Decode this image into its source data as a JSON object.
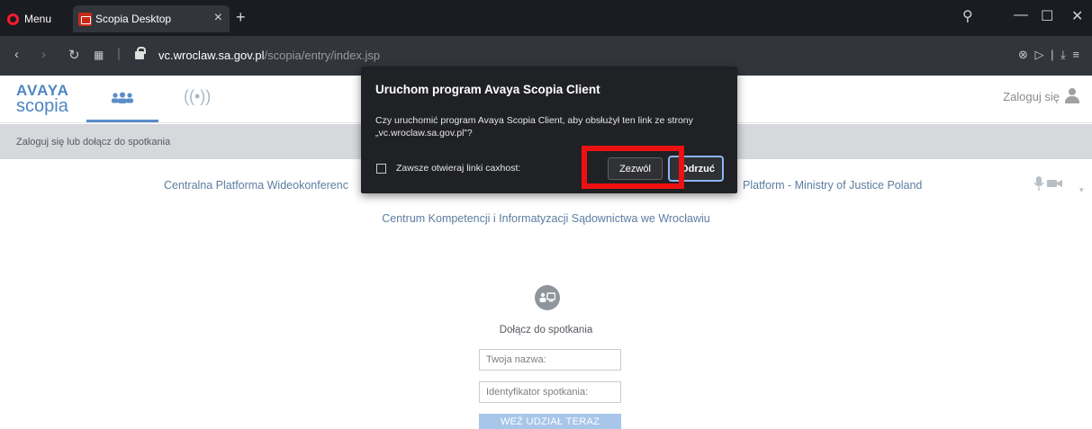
{
  "browser": {
    "menu_label": "Menu",
    "tab_title": "Scopia Desktop",
    "tab_close": "×",
    "new_tab": "+",
    "url_host": "vc.wroclaw.sa.gov.pl",
    "url_path": "/scopia/entry/index.jsp",
    "window_controls": {
      "search": "⚲",
      "minimize": "—",
      "maximize": "☐",
      "close": "✕"
    },
    "right_icons": "⊗ ▷ | ⤓ ≡",
    "brand_color": "#ff1b2d"
  },
  "header": {
    "logo_top": "AVAYA",
    "logo_bottom": "scopia",
    "people_icon": "people-icon",
    "broadcast_icon": "((•))",
    "login_label": "Zaloguj się",
    "accent_color": "#5b8ec9"
  },
  "subbar": {
    "text": "Zaloguj się lub dołącz do spotkania"
  },
  "main": {
    "platform_left": "Centralna Platforma Wideokonferenc",
    "platform_right": "Platform - Ministry of Justice Poland",
    "center_line": "Centrum Kompetencji i Informatyzacji Sądownictwa we Wrocławiu",
    "join_title": "Dołącz do spotkania",
    "name_placeholder": "Twoja nazwa:",
    "meeting_id_placeholder": "Identyfikator spotkania:",
    "join_button": "WEŹ UDZIAŁ TERAZ"
  },
  "dialog": {
    "title": "Uruchom program Avaya Scopia Client",
    "message": "Czy uruchomić program Avaya Scopia Client, aby obsłużył ten link ze strony „vc.wroclaw.sa.gov.pl”?",
    "checkbox_label": "Zawsze otwieraj linki caxhost:",
    "allow_button": "Zezwól",
    "reject_button": "Odrzuć",
    "highlight_color": "#ee1111"
  }
}
